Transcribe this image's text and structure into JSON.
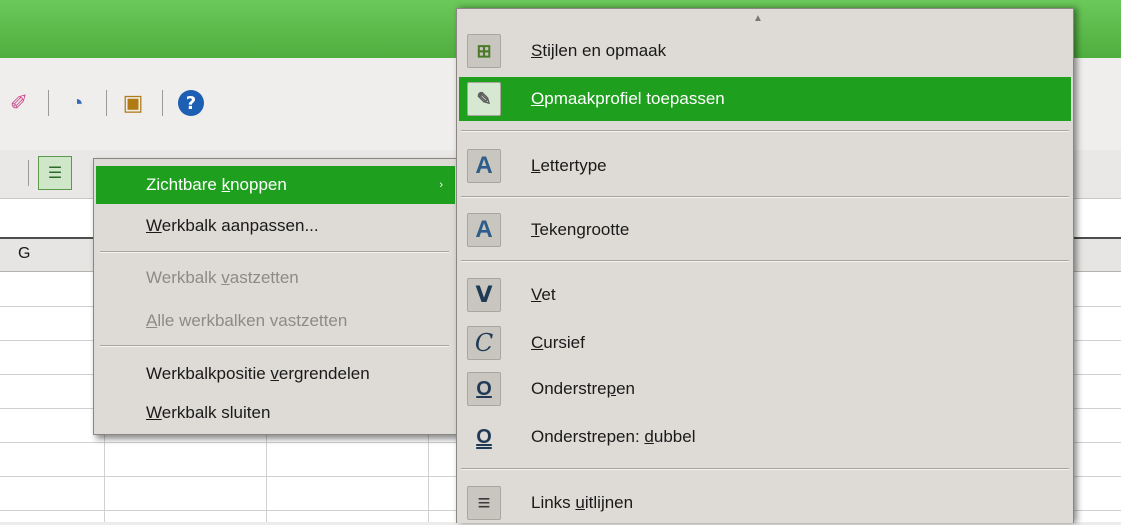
{
  "spreadsheet": {
    "column_label": "G"
  },
  "context_menu": {
    "items": [
      {
        "pre": "Zichtbare ",
        "key": "k",
        "post": "noppen",
        "has_submenu": true,
        "state": "highlighted"
      },
      {
        "pre": "",
        "key": "W",
        "post": "erkbalk aanpassen...",
        "state": "normal"
      },
      {
        "pre": "Werkbalk ",
        "key": "v",
        "post": "astzetten",
        "state": "disabled"
      },
      {
        "pre": "",
        "key": "A",
        "post": "lle werkbalken vastzetten",
        "state": "disabled"
      },
      {
        "pre": "Werkbalkpositie ",
        "key": "v",
        "post": "ergrendelen",
        "state": "normal"
      },
      {
        "pre": "",
        "key": "W",
        "post": "erkbalk sluiten",
        "state": "normal"
      }
    ],
    "submenu_arrow": "›"
  },
  "submenu": {
    "scroll_up": "▲",
    "items": [
      {
        "icon": "styles-icon",
        "glyph": "⊞",
        "pre": "",
        "key": "S",
        "post": "tijlen en opmaak",
        "state": "normal"
      },
      {
        "icon": "apply-style-icon",
        "glyph": "✎",
        "pre": "",
        "key": "O",
        "post": "pmaakprofiel toepassen",
        "state": "highlighted"
      },
      {
        "icon": "font-name-icon",
        "glyph": "A",
        "pre": "",
        "key": "L",
        "post": "ettertype",
        "state": "normal"
      },
      {
        "icon": "font-size-icon",
        "glyph": "A",
        "pre": "",
        "key": "T",
        "post": "ekengrootte",
        "state": "normal"
      },
      {
        "icon": "bold-icon",
        "glyph": "V",
        "pre": "",
        "key": "V",
        "post": "et",
        "state": "normal"
      },
      {
        "icon": "italic-icon",
        "glyph": "C",
        "pre": "",
        "key": "C",
        "post": "ursief",
        "state": "normal"
      },
      {
        "icon": "underline-icon",
        "glyph": "O",
        "pre": "Onderstre",
        "key": "p",
        "post": "en",
        "state": "normal"
      },
      {
        "icon": "double-underline-icon",
        "glyph": "O",
        "pre": "Onderstrepen: ",
        "key": "d",
        "post": "ubbel",
        "state": "normal"
      },
      {
        "icon": "align-left-icon",
        "glyph": "≡",
        "pre": "Links ",
        "key": "u",
        "post": "itlijnen",
        "state": "normal"
      }
    ]
  },
  "colors": {
    "highlight": "#1ea01e",
    "menu_bg": "#dedbd6",
    "title_green": "#5cbb4a"
  }
}
